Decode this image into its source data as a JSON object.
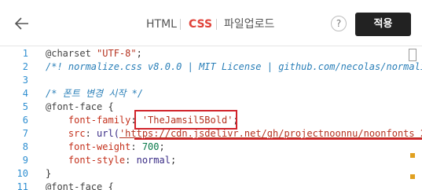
{
  "toolbar": {
    "back_icon": "arrow-left-icon",
    "tabs": [
      {
        "label": "HTML"
      },
      {
        "label": "CSS"
      },
      {
        "label": "파일업로드"
      }
    ],
    "help_label": "?",
    "apply_label": "적용",
    "active_color": "#e0433a"
  },
  "editor": {
    "lines": [
      {
        "num": "1",
        "parts": [
          [
            "at",
            "@charset "
          ],
          [
            "str",
            "\"UTF-8\""
          ],
          [
            "plain",
            ";"
          ]
        ]
      },
      {
        "num": "2",
        "parts": [
          [
            "comment",
            "/*! normalize.css v8.0.0 | MIT License | github.com/necolas/normaliz"
          ]
        ]
      },
      {
        "num": "3",
        "parts": []
      },
      {
        "num": "4",
        "parts": [
          [
            "comment",
            "/* 폰트 변경 시작 */"
          ]
        ]
      },
      {
        "num": "5",
        "parts": [
          [
            "at",
            "@font-face "
          ],
          [
            "plain",
            "{"
          ]
        ]
      },
      {
        "num": "6",
        "parts": [
          [
            "prop",
            "    font-family"
          ],
          [
            "plain",
            ": "
          ],
          [
            "str",
            "'TheJamsil5Bold'"
          ],
          [
            "plain",
            ";"
          ]
        ]
      },
      {
        "num": "7",
        "parts": [
          [
            "prop",
            "    src"
          ],
          [
            "plain",
            ": "
          ],
          [
            "val",
            "url("
          ],
          [
            "url",
            "'https://cdn.jsdelivr.net/gh/projectnoonnu/noonfonts_2"
          ]
        ]
      },
      {
        "num": "8",
        "parts": [
          [
            "prop",
            "    font-weight"
          ],
          [
            "plain",
            ": "
          ],
          [
            "num",
            "700"
          ],
          [
            "plain",
            ";"
          ]
        ]
      },
      {
        "num": "9",
        "parts": [
          [
            "prop",
            "    font-style"
          ],
          [
            "plain",
            ": "
          ],
          [
            "val",
            "normal"
          ],
          [
            "plain",
            ";"
          ]
        ]
      },
      {
        "num": "10",
        "parts": [
          [
            "plain",
            "}"
          ]
        ]
      },
      {
        "num": "11",
        "parts": [
          [
            "at",
            "@font-face "
          ],
          [
            "plain",
            "{"
          ]
        ]
      }
    ]
  }
}
